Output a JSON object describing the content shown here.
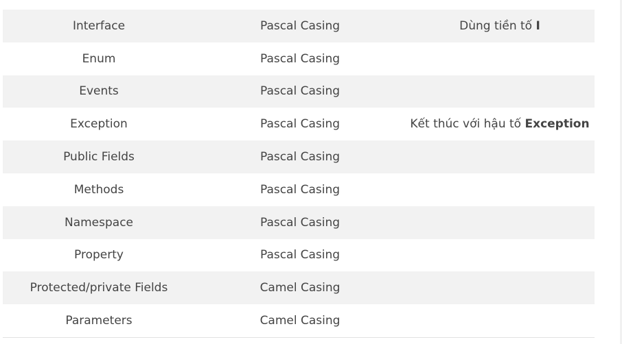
{
  "rows": [
    {
      "name": "Interface",
      "casing": "Pascal Casing",
      "note_prefix": "Dùng tiền tố ",
      "note_bold": "I"
    },
    {
      "name": "Enum",
      "casing": "Pascal Casing",
      "note_prefix": "",
      "note_bold": ""
    },
    {
      "name": "Events",
      "casing": "Pascal Casing",
      "note_prefix": "",
      "note_bold": ""
    },
    {
      "name": "Exception",
      "casing": "Pascal Casing",
      "note_prefix": "Kết thúc với hậu tố ",
      "note_bold": "Exception"
    },
    {
      "name": "Public Fields",
      "casing": "Pascal Casing",
      "note_prefix": "",
      "note_bold": ""
    },
    {
      "name": "Methods",
      "casing": "Pascal Casing",
      "note_prefix": "",
      "note_bold": ""
    },
    {
      "name": "Namespace",
      "casing": "Pascal Casing",
      "note_prefix": "",
      "note_bold": ""
    },
    {
      "name": "Property",
      "casing": "Pascal Casing",
      "note_prefix": "",
      "note_bold": ""
    },
    {
      "name": "Protected/private Fields",
      "casing": "Camel Casing",
      "note_prefix": "",
      "note_bold": ""
    },
    {
      "name": "Parameters",
      "casing": "Camel Casing",
      "note_prefix": "",
      "note_bold": ""
    }
  ],
  "colors": {
    "stripe": "#f2f2f2",
    "text": "#444444"
  }
}
